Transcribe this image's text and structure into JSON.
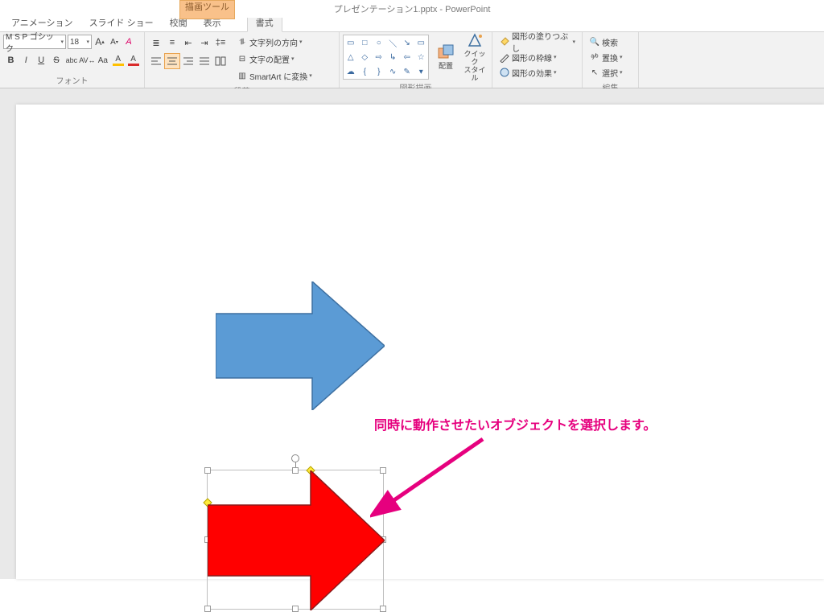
{
  "app": {
    "title": "プレゼンテーション1.pptx - PowerPoint"
  },
  "drawtools": {
    "line1": "描画ツール",
    "line2": "書式"
  },
  "tabs": {
    "animation": "アニメーション",
    "slideshow": "スライド ショー",
    "review": "校閲",
    "view": "表示",
    "format": "書式"
  },
  "font": {
    "name": "M S  P ゴシック",
    "size": "18",
    "grow": "A",
    "shrink": "A",
    "clear": "A",
    "bold": "B",
    "italic": "I",
    "underline": "U",
    "strike": "S",
    "shadow": "abc",
    "spacing": "AV",
    "case": "Aa",
    "color": "A",
    "group_label": "フォント"
  },
  "para": {
    "text_dir": "文字列の方向",
    "text_align": "文字の配置",
    "smartart": "SmartArt に変換",
    "group_label": "段落"
  },
  "shapes": {
    "arrange": "配置",
    "quickstyle": "クイック\nスタイル",
    "fill": "図形の塗りつぶし",
    "outline": "図形の枠線",
    "effects": "図形の効果",
    "group_label": "図形描画"
  },
  "edit": {
    "find": "検索",
    "replace": "置換",
    "select": "選択",
    "group_label": "編集"
  },
  "annotation": {
    "text": "同時に動作させたいオブジェクトを選択します。"
  }
}
